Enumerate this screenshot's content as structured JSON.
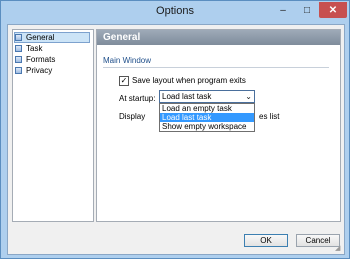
{
  "window": {
    "title": "Options"
  },
  "controls": {
    "minimize": "–",
    "maximize": "□",
    "close": "✕"
  },
  "tree": {
    "items": [
      {
        "label": "General",
        "selected": true
      },
      {
        "label": "Task"
      },
      {
        "label": "Formats"
      },
      {
        "label": "Privacy"
      }
    ]
  },
  "panel": {
    "header": "General",
    "section": "Main Window",
    "save_layout_label": "Save layout when program exits",
    "save_layout_checked": "✓",
    "startup_label": "At startup:",
    "startup_value": "Load last task",
    "startup_options": [
      "Load an empty task",
      "Load last task",
      "Show empty workspace"
    ],
    "display_label": "Display",
    "files_list_label": "es list"
  },
  "buttons": {
    "ok": "OK",
    "cancel": "Cancel"
  },
  "colors": {
    "accent": "#3399ff",
    "header": "#8d99a8"
  }
}
